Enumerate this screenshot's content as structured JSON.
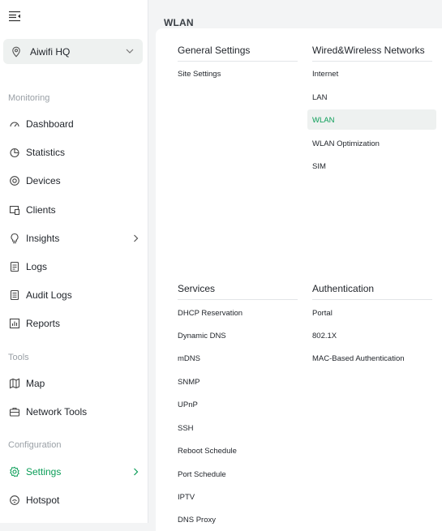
{
  "sidebar": {
    "site_name": "Aiwifi HQ",
    "sections": {
      "monitoring": "Monitoring",
      "tools": "Tools",
      "configuration": "Configuration"
    },
    "items": [
      {
        "label": "Dashboard",
        "icon": "gauge-icon"
      },
      {
        "label": "Statistics",
        "icon": "pie-chart-icon"
      },
      {
        "label": "Devices",
        "icon": "target-icon"
      },
      {
        "label": "Clients",
        "icon": "clients-icon"
      },
      {
        "label": "Insights",
        "icon": "lightbulb-icon"
      },
      {
        "label": "Logs",
        "icon": "document-icon"
      },
      {
        "label": "Audit Logs",
        "icon": "list-document-icon"
      },
      {
        "label": "Reports",
        "icon": "bar-chart-icon"
      },
      {
        "label": "Map",
        "icon": "map-icon"
      },
      {
        "label": "Network Tools",
        "icon": "toolbox-icon"
      },
      {
        "label": "Settings",
        "icon": "gear-icon"
      },
      {
        "label": "Hotspot",
        "icon": "hotspot-icon"
      }
    ],
    "accent": "#0a9d57"
  },
  "page": {
    "title": "WLAN"
  },
  "menu": {
    "general": {
      "title": "General Settings",
      "links": [
        "Site Settings"
      ]
    },
    "wired_wireless": {
      "title": "Wired&Wireless Networks",
      "links": [
        "Internet",
        "LAN",
        "WLAN",
        "WLAN Optimization",
        "SIM"
      ],
      "active": "WLAN"
    },
    "services": {
      "title": "Services",
      "links": [
        "DHCP Reservation",
        "Dynamic DNS",
        "mDNS",
        "SNMP",
        "UPnP",
        "SSH",
        "Reboot Schedule",
        "Port Schedule",
        "IPTV",
        "DNS Proxy"
      ]
    },
    "authentication": {
      "title": "Authentication",
      "links": [
        "Portal",
        "802.1X",
        "MAC-Based Authentication"
      ]
    }
  }
}
